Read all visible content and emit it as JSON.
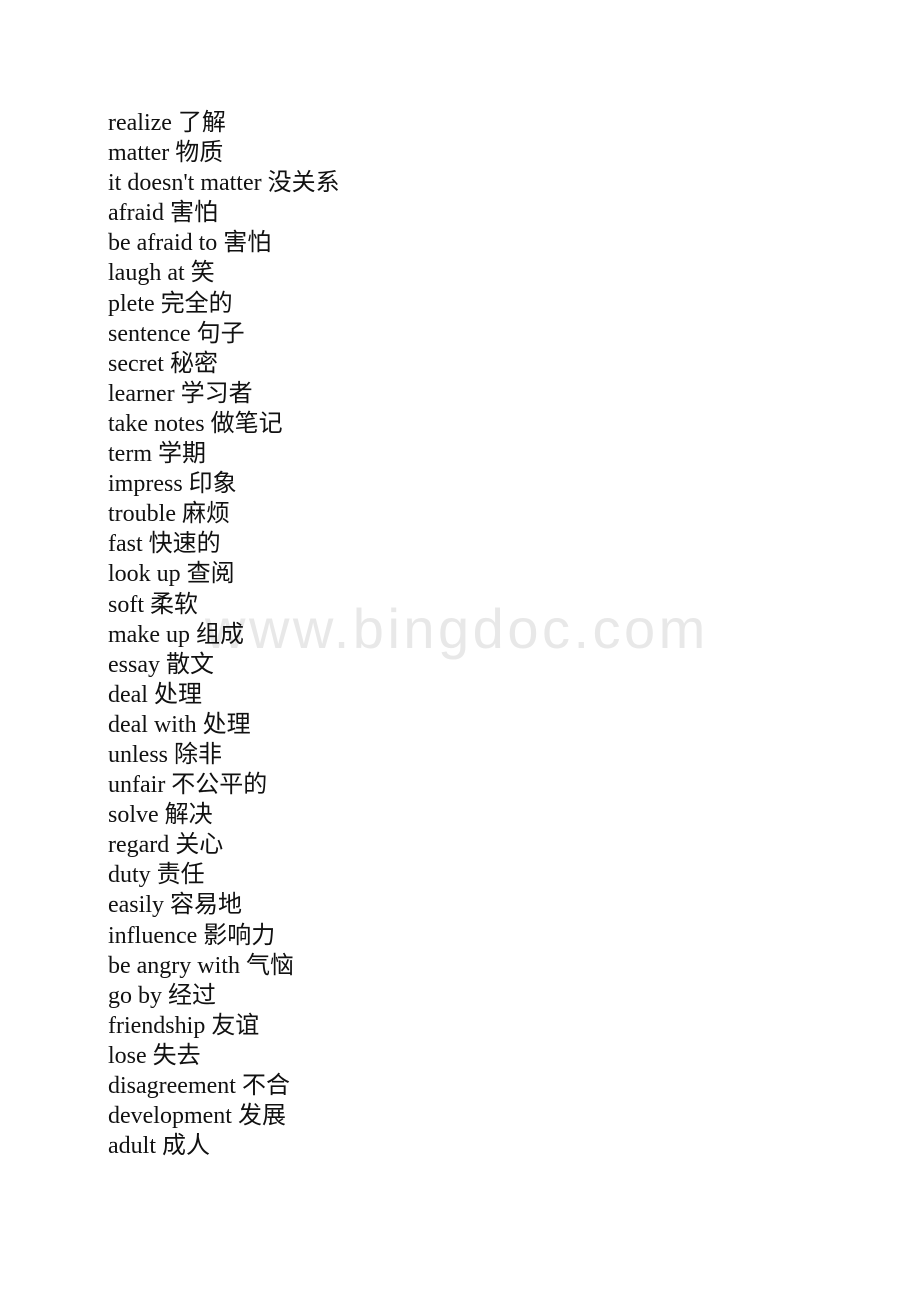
{
  "document": {
    "type": "vocabulary-list",
    "background_color": "#ffffff",
    "text_color": "#111111"
  },
  "watermark": {
    "text": "www.bingdoc.com",
    "color": "#e8e8e8"
  },
  "vocabulary": {
    "entries": [
      {
        "term": "realize",
        "translation": "了解",
        "line": "realize 了解"
      },
      {
        "term": "matter",
        "translation": "物质",
        "line": "matter 物质"
      },
      {
        "term": "it doesn't matter",
        "translation": "没关系",
        "line": "it doesn't matter 没关系"
      },
      {
        "term": "afraid",
        "translation": "害怕",
        "line": "afraid 害怕"
      },
      {
        "term": "be afraid to",
        "translation": "害怕",
        "line": "be afraid to 害怕"
      },
      {
        "term": "laugh at",
        "translation": "笑",
        "line": "laugh at 笑"
      },
      {
        "term": "plete",
        "translation": "完全的",
        "line": "plete 完全的"
      },
      {
        "term": "sentence",
        "translation": "句子",
        "line": "sentence 句子"
      },
      {
        "term": "secret",
        "translation": "秘密",
        "line": "secret 秘密"
      },
      {
        "term": "learner",
        "translation": "学习者",
        "line": "learner 学习者"
      },
      {
        "term": "take notes",
        "translation": "做笔记",
        "line": "take notes 做笔记"
      },
      {
        "term": "term",
        "translation": "学期",
        "line": "term 学期"
      },
      {
        "term": "impress",
        "translation": "印象",
        "line": "impress 印象"
      },
      {
        "term": "trouble",
        "translation": "麻烦",
        "line": "trouble 麻烦"
      },
      {
        "term": "fast",
        "translation": "快速的",
        "line": "fast 快速的"
      },
      {
        "term": "look up",
        "translation": "查阅",
        "line": "look up 查阅"
      },
      {
        "term": "soft",
        "translation": "柔软",
        "line": "soft 柔软"
      },
      {
        "term": "make up",
        "translation": "组成",
        "line": "make up 组成"
      },
      {
        "term": "essay",
        "translation": "散文",
        "line": "essay 散文"
      },
      {
        "term": "deal",
        "translation": "处理",
        "line": "deal 处理"
      },
      {
        "term": "deal with",
        "translation": "处理",
        "line": "deal with 处理"
      },
      {
        "term": "unless",
        "translation": "除非",
        "line": "unless 除非"
      },
      {
        "term": "unfair",
        "translation": "不公平的",
        "line": "unfair 不公平的"
      },
      {
        "term": "solve",
        "translation": "解决",
        "line": "solve 解决"
      },
      {
        "term": "regard",
        "translation": "关心",
        "line": "regard 关心"
      },
      {
        "term": "duty",
        "translation": "责任",
        "line": "duty 责任"
      },
      {
        "term": "easily",
        "translation": "容易地",
        "line": "easily 容易地"
      },
      {
        "term": "influence",
        "translation": "影响力",
        "line": "influence 影响力"
      },
      {
        "term": "be angry with",
        "translation": "气恼",
        "line": "be angry with 气恼"
      },
      {
        "term": "go by",
        "translation": "经过",
        "line": "go by 经过"
      },
      {
        "term": "friendship",
        "translation": "友谊",
        "line": "friendship 友谊"
      },
      {
        "term": "lose",
        "translation": "失去",
        "line": "lose 失去"
      },
      {
        "term": "disagreement",
        "translation": "不合",
        "line": "disagreement 不合"
      },
      {
        "term": "development",
        "translation": "发展",
        "line": "development 发展"
      },
      {
        "term": "adult",
        "translation": "成人",
        "line": "adult 成人"
      }
    ]
  }
}
